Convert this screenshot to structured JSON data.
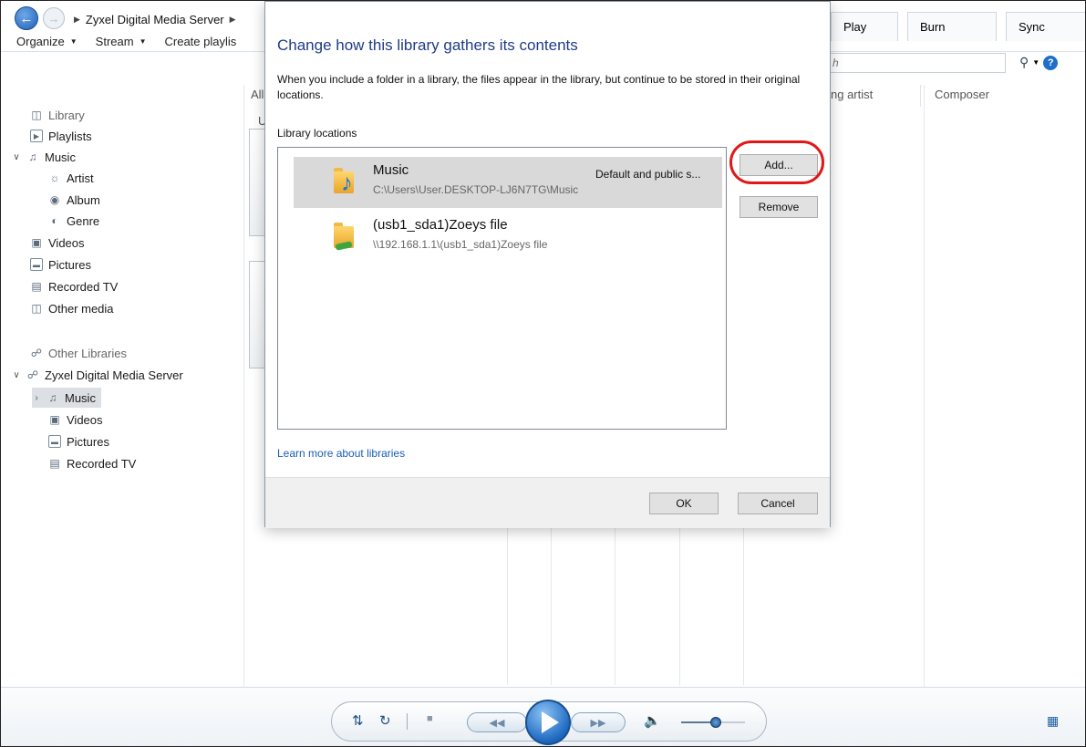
{
  "window": {
    "breadcrumb": [
      "Zyxel Digital Media Server"
    ]
  },
  "toolbar": {
    "organize": "Organize",
    "stream": "Stream",
    "create_playlist": "Create playlis"
  },
  "tabs": {
    "play": "Play",
    "burn": "Burn",
    "sync": "Sync"
  },
  "search": {
    "placeholder_fragment": "h"
  },
  "columns": {
    "all_fragment": "All",
    "u_fragment": "U",
    "artist_fragment": "ng artist",
    "composer": "Composer"
  },
  "navpane": {
    "library": "Library",
    "playlists": "Playlists",
    "music": "Music",
    "artist": "Artist",
    "album": "Album",
    "genre": "Genre",
    "videos": "Videos",
    "pictures": "Pictures",
    "recorded_tv": "Recorded TV",
    "other_media": "Other media",
    "other_libraries": "Other Libraries",
    "zyxel_server": "Zyxel Digital Media Server",
    "z_music": "Music",
    "z_videos": "Videos",
    "z_pictures": "Pictures",
    "z_recorded_tv": "Recorded TV"
  },
  "dialog": {
    "title": "Change how this library gathers its contents",
    "description": "When you include a folder in a library, the files appear in the library, but continue to be stored in their original locations.",
    "locations_label": "Library locations",
    "locations": [
      {
        "name": "Music",
        "path": "C:\\Users\\User.DESKTOP-LJ6N7TG\\Music",
        "tag": "Default and public s...",
        "icon": "music-folder-icon"
      },
      {
        "name": "(usb1_sda1)Zoeys file",
        "path": "\\\\192.168.1.1\\(usb1_sda1)Zoeys file",
        "tag": "",
        "icon": "network-folder-icon"
      }
    ],
    "add_label": "Add...",
    "remove_label": "Remove",
    "learn_more": "Learn more about libraries",
    "ok_label": "OK",
    "cancel_label": "Cancel"
  },
  "colors": {
    "title_blue": "#1f3c88",
    "link_blue": "#1a5fb4",
    "highlight_red": "#e01818",
    "selected_gray": "#d9d9d9"
  }
}
